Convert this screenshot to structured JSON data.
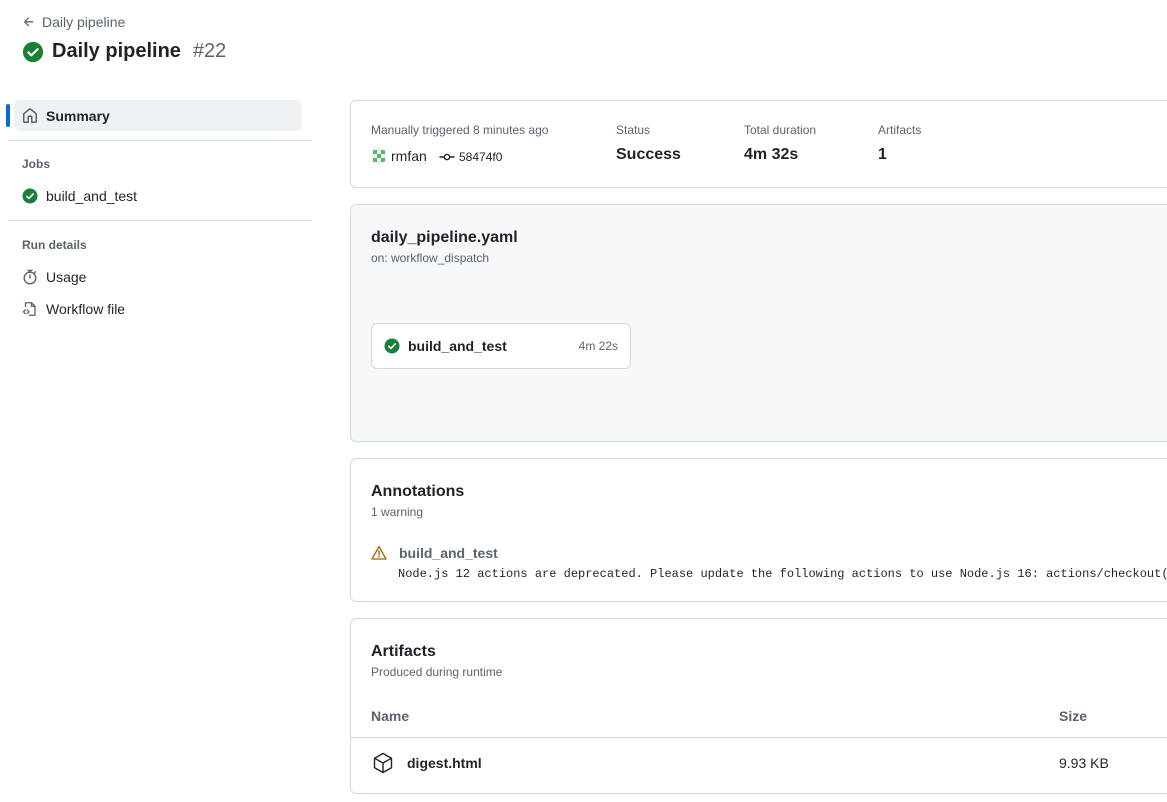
{
  "header": {
    "back_label": "Daily pipeline",
    "title": "Daily pipeline",
    "run_number": "#22"
  },
  "sidebar": {
    "summary_label": "Summary",
    "jobs_heading": "Jobs",
    "jobs": [
      {
        "label": "build_and_test",
        "status": "success"
      }
    ],
    "run_details_heading": "Run details",
    "run_details": [
      {
        "label": "Usage",
        "icon": "stopwatch-icon"
      },
      {
        "label": "Workflow file",
        "icon": "file-code-icon"
      }
    ]
  },
  "summary": {
    "trigger_text": "Manually triggered 8 minutes ago",
    "actor": "rmfan",
    "commit": "58474f0",
    "status_label": "Status",
    "status_value": "Success",
    "duration_label": "Total duration",
    "duration_value": "4m 32s",
    "artifacts_label": "Artifacts",
    "artifacts_value": "1"
  },
  "workflow": {
    "file_name": "daily_pipeline.yaml",
    "trigger": "on: workflow_dispatch",
    "job": {
      "name": "build_and_test",
      "duration": "4m 22s"
    }
  },
  "annotations": {
    "title": "Annotations",
    "subtitle": "1 warning",
    "items": [
      {
        "job": "build_and_test",
        "message": "Node.js 12 actions are deprecated. Please update the following actions to use Node.js 16: actions/checkout("
      }
    ]
  },
  "artifacts": {
    "title": "Artifacts",
    "subtitle": "Produced during runtime",
    "columns": {
      "name": "Name",
      "size": "Size"
    },
    "rows": [
      {
        "name": "digest.html",
        "size": "9.93 KB"
      }
    ]
  },
  "colors": {
    "success": "#1a7f37",
    "warning": "#9a6700",
    "accent": "#0969da"
  }
}
